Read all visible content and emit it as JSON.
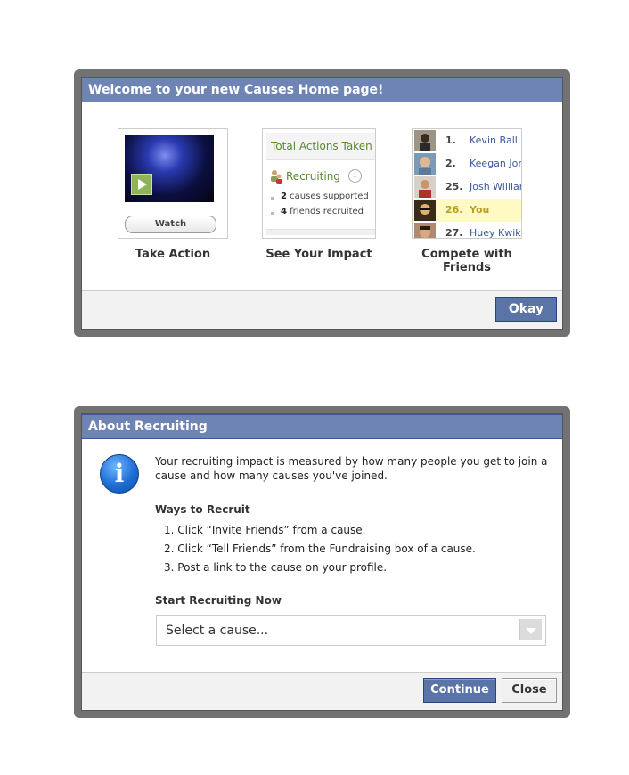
{
  "dialog1": {
    "title": "Welcome to your new Causes Home page!",
    "panels": {
      "take_action": {
        "caption": "Take Action",
        "watch_label": "Watch"
      },
      "impact": {
        "caption": "See Your Impact",
        "header": "Total Actions Taken",
        "recruiting_label": "Recruiting",
        "info_glyph": "i",
        "lines": [
          {
            "count": "2",
            "text": "causes supported"
          },
          {
            "count": "4",
            "text": "friends recruited"
          }
        ]
      },
      "compete": {
        "caption": "Compete with Friends",
        "rows": [
          {
            "rank": "1.",
            "name": "Kevin Ball",
            "highlight": false
          },
          {
            "rank": "2.",
            "name": "Keegan Jones",
            "highlight": false
          },
          {
            "rank": "25.",
            "name": "Josh Williams",
            "highlight": false
          },
          {
            "rank": "26.",
            "name": "You",
            "highlight": true
          },
          {
            "rank": "27.",
            "name": "Huey Kwik",
            "highlight": false
          }
        ]
      }
    },
    "okay_label": "Okay"
  },
  "dialog2": {
    "title": "About Recruiting",
    "info_glyph": "i",
    "intro_line1": "Your recruiting impact is measured by how many people you get to join a",
    "intro_line2": "cause and how many causes you've joined.",
    "ways_heading": "Ways to Recruit",
    "ways": [
      "1. Click “Invite Friends” from a cause.",
      "2. Click “Tell Friends” from the Fundraising box of a cause.",
      "3. Post a link to the cause on your profile."
    ],
    "start_heading": "Start Recruiting Now",
    "select_value": "Select a cause...",
    "continue_label": "Continue",
    "close_label": "Close"
  },
  "colors": {
    "title_bar": "#6d84b4",
    "button_blue": "#5b74a8",
    "link": "#3b5998",
    "accent_green": "#5b8a2e",
    "highlight": "#fff9c4"
  }
}
